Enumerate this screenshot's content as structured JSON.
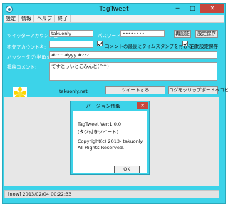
{
  "window": {
    "title": "TagTweet",
    "minimize_label": "─",
    "maximize_label": "□",
    "close_label": "✕"
  },
  "menu": [
    "設定",
    "情報",
    "ヘルプ",
    "終了"
  ],
  "fields": {
    "account_label": "ツイッターアカウント名:",
    "account_value": "takuonly",
    "password_label": "パスワード:",
    "password_value": "••••••••",
    "reauth_button": "再認証",
    "save_settings_button": "設定保存",
    "alt_account_label": "宛先アカウント名:",
    "alt_account_value": "",
    "timestamp_check_label": "コメントの最後にタイムスタンプを付ける",
    "auto_save_check_label": "自動設定保存",
    "hashtag_label": "ハッシュタグ(半角文字列):",
    "hashtag_value": "#ccc #yyy #zzz",
    "comment_label": "投稿コメント:",
    "comment_value": "てすとっいとこみんと(^^)",
    "user_link": "takuonly.net",
    "tweet_button": "ツイートする",
    "copy_log_button": "ログをクリップボードへコピー"
  },
  "dialog": {
    "title": "バージョン情報",
    "close_label": "✕",
    "app_name": "TagTweet  Ver:1.0.0",
    "subtitle": "[タグ付きツイート]",
    "copyright": "Copyright(c) 2013- takuonly.",
    "rights": "All Rights Reserved.",
    "ok_button": "OK"
  },
  "status": {
    "text": "[now] 2013/02/04 00:22:33"
  },
  "colors": {
    "accent": "#3cd3e9",
    "close": "#c7463c"
  }
}
